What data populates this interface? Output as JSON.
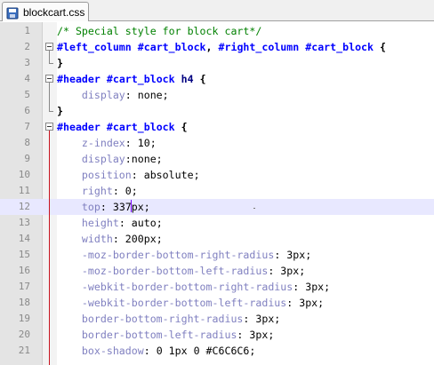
{
  "tab": {
    "label": "blockcart.css"
  },
  "current_line": 12,
  "lines": [
    {
      "n": "1",
      "tokens": [
        {
          "t": "/* Special style for block cart*/",
          "c": "comment"
        }
      ]
    },
    {
      "n": "2",
      "tokens": [
        {
          "t": "#left_column",
          "c": "id"
        },
        {
          "t": " ",
          "c": "val"
        },
        {
          "t": "#cart_block",
          "c": "id"
        },
        {
          "t": ", ",
          "c": "punc"
        },
        {
          "t": "#right_column",
          "c": "id"
        },
        {
          "t": " ",
          "c": "val"
        },
        {
          "t": "#cart_block",
          "c": "id"
        },
        {
          "t": " {",
          "c": "brace"
        }
      ]
    },
    {
      "n": "3",
      "tokens": [
        {
          "t": "}",
          "c": "brace"
        }
      ]
    },
    {
      "n": "4",
      "tokens": [
        {
          "t": "#header",
          "c": "id"
        },
        {
          "t": " ",
          "c": "val"
        },
        {
          "t": "#cart_block",
          "c": "id"
        },
        {
          "t": " h4",
          "c": "tag"
        },
        {
          "t": " {",
          "c": "brace"
        }
      ]
    },
    {
      "n": "5",
      "tokens": [
        {
          "t": "    display",
          "c": "prop"
        },
        {
          "t": ": none;",
          "c": "val"
        }
      ]
    },
    {
      "n": "6",
      "tokens": [
        {
          "t": "}",
          "c": "brace"
        }
      ]
    },
    {
      "n": "7",
      "tokens": [
        {
          "t": "#header",
          "c": "id"
        },
        {
          "t": " ",
          "c": "val"
        },
        {
          "t": "#cart_block",
          "c": "id"
        },
        {
          "t": " {",
          "c": "brace"
        }
      ]
    },
    {
      "n": "8",
      "tokens": [
        {
          "t": "    z-index",
          "c": "prop"
        },
        {
          "t": ": 10;",
          "c": "val"
        }
      ]
    },
    {
      "n": "9",
      "tokens": [
        {
          "t": "    display",
          "c": "prop"
        },
        {
          "t": ":none;",
          "c": "val"
        }
      ]
    },
    {
      "n": "10",
      "tokens": [
        {
          "t": "    position",
          "c": "prop"
        },
        {
          "t": ": absolute;",
          "c": "val"
        }
      ]
    },
    {
      "n": "11",
      "tokens": [
        {
          "t": "    right",
          "c": "prop"
        },
        {
          "t": ": 0;",
          "c": "val"
        }
      ]
    },
    {
      "n": "12",
      "tokens": [
        {
          "t": "    top",
          "c": "prop"
        },
        {
          "t": ": 337",
          "c": "val"
        },
        {
          "t": "|",
          "c": "caret"
        },
        {
          "t": "px;",
          "c": "val"
        }
      ]
    },
    {
      "n": "13",
      "tokens": [
        {
          "t": "    height",
          "c": "prop"
        },
        {
          "t": ": auto;",
          "c": "val"
        }
      ]
    },
    {
      "n": "14",
      "tokens": [
        {
          "t": "    width",
          "c": "prop"
        },
        {
          "t": ": 200px;",
          "c": "val"
        }
      ]
    },
    {
      "n": "15",
      "tokens": [
        {
          "t": "    -moz-border-bottom-right-radius",
          "c": "prop"
        },
        {
          "t": ": 3px;",
          "c": "val"
        }
      ]
    },
    {
      "n": "16",
      "tokens": [
        {
          "t": "    -moz-border-bottom-left-radius",
          "c": "prop"
        },
        {
          "t": ": 3px;",
          "c": "val"
        }
      ]
    },
    {
      "n": "17",
      "tokens": [
        {
          "t": "    -webkit-border-bottom-right-radius",
          "c": "prop"
        },
        {
          "t": ": 3px;",
          "c": "val"
        }
      ]
    },
    {
      "n": "18",
      "tokens": [
        {
          "t": "    -webkit-border-bottom-left-radius",
          "c": "prop"
        },
        {
          "t": ": 3px;",
          "c": "val"
        }
      ]
    },
    {
      "n": "19",
      "tokens": [
        {
          "t": "    border-bottom-right-radius",
          "c": "prop"
        },
        {
          "t": ": 3px;",
          "c": "val"
        }
      ]
    },
    {
      "n": "20",
      "tokens": [
        {
          "t": "    border-bottom-left-radius",
          "c": "prop"
        },
        {
          "t": ": 3px;",
          "c": "val"
        }
      ]
    },
    {
      "n": "21",
      "tokens": [
        {
          "t": "    box-shadow",
          "c": "prop"
        },
        {
          "t": ": 0 1px 0 #C6C6C6;",
          "c": "val"
        }
      ]
    }
  ],
  "colors": {
    "comment": "#008000",
    "id": "#0000ff",
    "property": "#8080c0",
    "fold_line": "#c8121e",
    "current_line_bg": "#e8e8ff"
  }
}
